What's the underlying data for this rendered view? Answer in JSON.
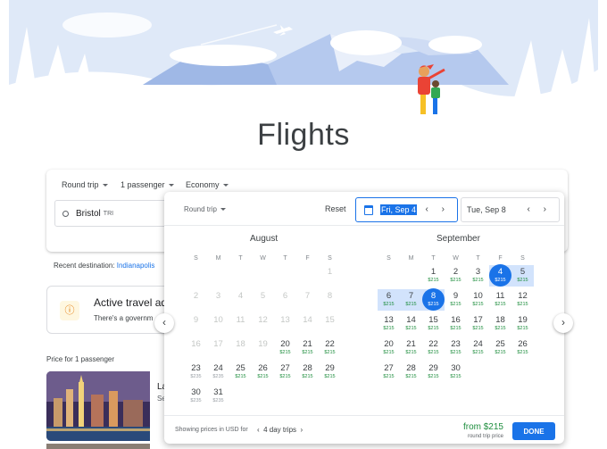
{
  "page": {
    "title": "Flights"
  },
  "search": {
    "trip_type": "Round trip",
    "passengers": "1 passenger",
    "cabin": "Economy",
    "origin": "Bristol",
    "origin_code": "TRI"
  },
  "recent": {
    "label": "Recent destination:",
    "link": "Indianapolis"
  },
  "travel_card": {
    "title": "Active travel ad",
    "text": "There's a governm"
  },
  "price_section": {
    "label": "Price for 1 passenger",
    "peek_title": "La",
    "peek_sub": "Se"
  },
  "calendar": {
    "trip_type": "Round trip",
    "reset": "Reset",
    "depart": "Fri, Sep 4",
    "return": "Tue, Sep 8",
    "weekdays": [
      "S",
      "M",
      "T",
      "W",
      "T",
      "F",
      "S"
    ],
    "august": {
      "name": "August",
      "rows": [
        [
          null,
          null,
          null,
          null,
          null,
          null,
          {
            "d": "1",
            "p": ""
          }
        ],
        [
          {
            "d": "2",
            "p": ""
          },
          {
            "d": "3",
            "p": ""
          },
          {
            "d": "4",
            "p": ""
          },
          {
            "d": "5",
            "p": ""
          },
          {
            "d": "6",
            "p": ""
          },
          {
            "d": "7",
            "p": ""
          },
          {
            "d": "8",
            "p": ""
          }
        ],
        [
          {
            "d": "9",
            "p": ""
          },
          {
            "d": "10",
            "p": ""
          },
          {
            "d": "11",
            "p": ""
          },
          {
            "d": "12",
            "p": ""
          },
          {
            "d": "13",
            "p": ""
          },
          {
            "d": "14",
            "p": ""
          },
          {
            "d": "15",
            "p": ""
          }
        ],
        [
          {
            "d": "16",
            "p": ""
          },
          {
            "d": "17",
            "p": ""
          },
          {
            "d": "18",
            "p": ""
          },
          {
            "d": "19",
            "p": ""
          },
          {
            "d": "20",
            "p": "$215"
          },
          {
            "d": "21",
            "p": "$215"
          },
          {
            "d": "22",
            "p": "$215"
          }
        ],
        [
          {
            "d": "23",
            "p": "$235"
          },
          {
            "d": "24",
            "p": "$235"
          },
          {
            "d": "25",
            "p": "$215"
          },
          {
            "d": "26",
            "p": "$215"
          },
          {
            "d": "27",
            "p": "$215"
          },
          {
            "d": "28",
            "p": "$215"
          },
          {
            "d": "29",
            "p": "$215"
          }
        ],
        [
          {
            "d": "30",
            "p": "$235"
          },
          {
            "d": "31",
            "p": "$235"
          },
          null,
          null,
          null,
          null,
          null
        ]
      ]
    },
    "september": {
      "name": "September",
      "rows": [
        [
          null,
          null,
          {
            "d": "1",
            "p": "$215"
          },
          {
            "d": "2",
            "p": "$215"
          },
          {
            "d": "3",
            "p": "$215"
          },
          {
            "d": "4",
            "p": "$215"
          },
          {
            "d": "5",
            "p": "$215"
          }
        ],
        [
          {
            "d": "6",
            "p": "$215"
          },
          {
            "d": "7",
            "p": "$215"
          },
          {
            "d": "8",
            "p": "$215"
          },
          {
            "d": "9",
            "p": "$215"
          },
          {
            "d": "10",
            "p": "$215"
          },
          {
            "d": "11",
            "p": "$215"
          },
          {
            "d": "12",
            "p": "$215"
          }
        ],
        [
          {
            "d": "13",
            "p": "$215"
          },
          {
            "d": "14",
            "p": "$215"
          },
          {
            "d": "15",
            "p": "$215"
          },
          {
            "d": "16",
            "p": "$215"
          },
          {
            "d": "17",
            "p": "$215"
          },
          {
            "d": "18",
            "p": "$215"
          },
          {
            "d": "19",
            "p": "$215"
          }
        ],
        [
          {
            "d": "20",
            "p": "$215"
          },
          {
            "d": "21",
            "p": "$215"
          },
          {
            "d": "22",
            "p": "$215"
          },
          {
            "d": "23",
            "p": "$215"
          },
          {
            "d": "24",
            "p": "$215"
          },
          {
            "d": "25",
            "p": "$215"
          },
          {
            "d": "26",
            "p": "$215"
          }
        ],
        [
          {
            "d": "27",
            "p": "$215"
          },
          {
            "d": "28",
            "p": "$215"
          },
          {
            "d": "29",
            "p": "$215"
          },
          {
            "d": "30",
            "p": "$215"
          },
          null,
          null,
          null
        ]
      ]
    },
    "footer": {
      "showing": "Showing prices in USD for",
      "trips": "4 day trips",
      "from_price": "from $215",
      "price_note": "round trip price",
      "done": "DONE"
    }
  },
  "colors": {
    "accent": "#1a73e8",
    "price": "#1e8e3e",
    "range": "#d2e3fc"
  }
}
